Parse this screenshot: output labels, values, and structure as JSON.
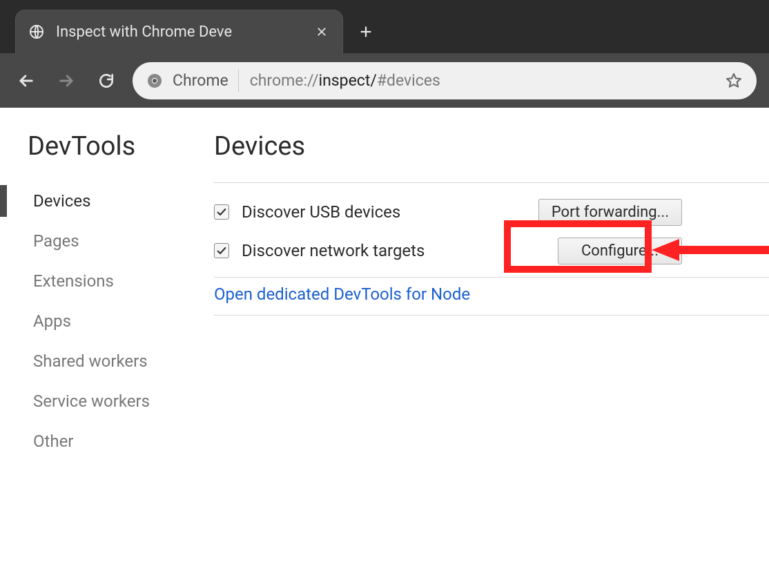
{
  "tab": {
    "title": "Inspect with Chrome Deve"
  },
  "address": {
    "scheme_label": "Chrome",
    "url_scheme": "chrome://",
    "url_path_strong": "inspect/",
    "url_hash": "#devices"
  },
  "sidebar": {
    "brand": "DevTools",
    "items": [
      {
        "label": "Devices",
        "active": true
      },
      {
        "label": "Pages",
        "active": false
      },
      {
        "label": "Extensions",
        "active": false
      },
      {
        "label": "Apps",
        "active": false
      },
      {
        "label": "Shared workers",
        "active": false
      },
      {
        "label": "Service workers",
        "active": false
      },
      {
        "label": "Other",
        "active": false
      }
    ]
  },
  "main": {
    "title": "Devices",
    "rows": [
      {
        "checked": true,
        "label": "Discover USB devices",
        "button": "Port forwarding..."
      },
      {
        "checked": true,
        "label": "Discover network targets",
        "button": "Configure..."
      }
    ],
    "node_link": "Open dedicated DevTools for Node"
  }
}
